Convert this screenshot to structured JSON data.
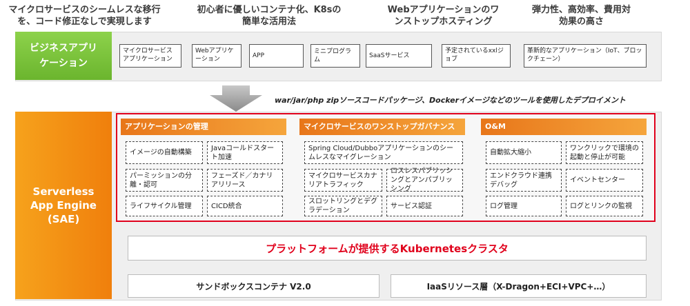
{
  "headlines": [
    "マイクロサービスのシームレスな移行を、コード修正なしで実現します",
    "初心者に優しいコンテナ化、K8sの簡単な活用法",
    "Webアプリケーションのワンストップホスティング",
    "弾力性、高効率、費用対効果の高さ"
  ],
  "business": {
    "label": "ビジネスアプリケーション",
    "items": [
      "マイクロサービスアプリケーション",
      "Webアプリケーション",
      "APP",
      "ミニプログラム",
      "SaaSサービス",
      "予定されているxxlジョブ",
      "革新的なアプリケーション（IoT、ブロックチェーン）"
    ]
  },
  "deploy_text": "war/jar/php zipソースコードパッケージ、Dockerイメージなどのツールを使用したデプロイメント",
  "sae_label": "Serverless App Engine (SAE)",
  "sections": [
    {
      "title": "アプリケーションの管理",
      "items": [
        "イメージの自動構築",
        "Javaコールドスタート加速",
        "パーミッションの分離・認可",
        "フェーズド／カナリアリリース",
        "ライフサイクル管理",
        "CICD統合"
      ]
    },
    {
      "title": "マイクロサービスのワンストップガバナンス",
      "items": [
        "Spring Cloud/Dubboアプリケーションのシームレスなマイグレーション",
        "マイクロサービスカナリアトラフィック",
        "ロスレスパブリッシングとアンパブリッシング",
        "スロットリングとデグラデーション",
        "サービス認証"
      ]
    },
    {
      "title": "O&M",
      "items": [
        "自動拡大縮小",
        "ワンクリックで環境の起動と停止が可能",
        "エンドクラウド連携デバッグ",
        "イベントセンター",
        "ログ管理",
        "ログとリンクの監視"
      ]
    }
  ],
  "k8s_text": "プラットフォームが提供するKubernetesクラスタ",
  "sandbox_text": "サンドボックスコンテナ V2.0",
  "iaas_text": "IaaSリソース層（X-Dragon+ECI+VPC+…）",
  "colors": {
    "green": "#7cc43a",
    "orange": "#f39414",
    "red_border": "#e0001b",
    "k8s_text": "#e0001b"
  }
}
